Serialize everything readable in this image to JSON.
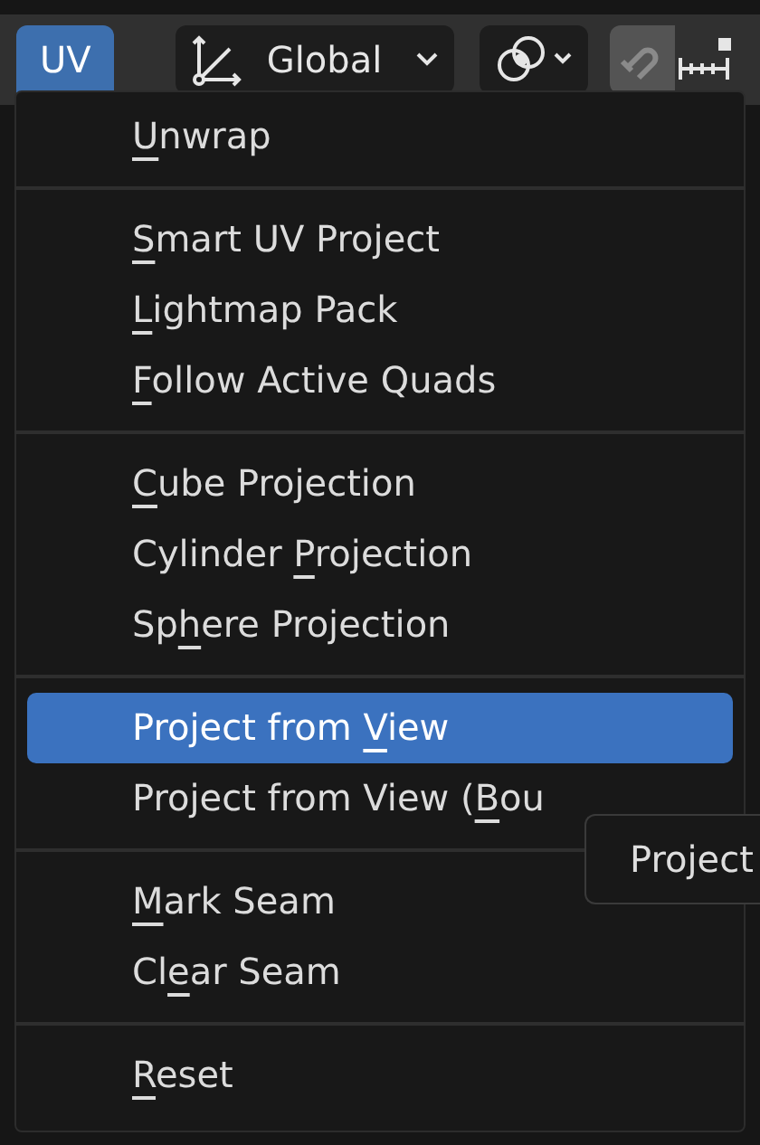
{
  "header": {
    "editor_button": {
      "label": "UV",
      "selected": true
    },
    "orientation_dropdown": {
      "label": "Global"
    },
    "snap_toggle": {
      "on": true
    }
  },
  "menu": {
    "sections": [
      [
        {
          "key": "U",
          "post": "nwrap",
          "selected": false
        }
      ],
      [
        {
          "key": "S",
          "post": "mart UV Project",
          "selected": false
        },
        {
          "key": "L",
          "post": "ightmap Pack",
          "selected": false
        },
        {
          "key": "F",
          "post": "ollow Active Quads",
          "selected": false
        }
      ],
      [
        {
          "key": "C",
          "post": "ube Projection",
          "selected": false
        },
        {
          "pre": "Cylinder ",
          "key": "P",
          "post": "rojection",
          "selected": false
        },
        {
          "pre": "Sp",
          "key": "h",
          "post": "ere Projection",
          "selected": false
        }
      ],
      [
        {
          "pre": "Project from ",
          "key": "V",
          "post": "iew",
          "selected": true
        },
        {
          "pre": "Project from View (",
          "key": "B",
          "post": "ou",
          "selected": false
        }
      ],
      [
        {
          "key": "M",
          "post": "ark Seam",
          "selected": false
        },
        {
          "pre": "Cl",
          "key": "e",
          "post": "ar Seam",
          "selected": false
        }
      ],
      [
        {
          "key": "R",
          "post": "eset",
          "selected": false
        }
      ]
    ]
  },
  "tooltip": {
    "text": "Project"
  }
}
